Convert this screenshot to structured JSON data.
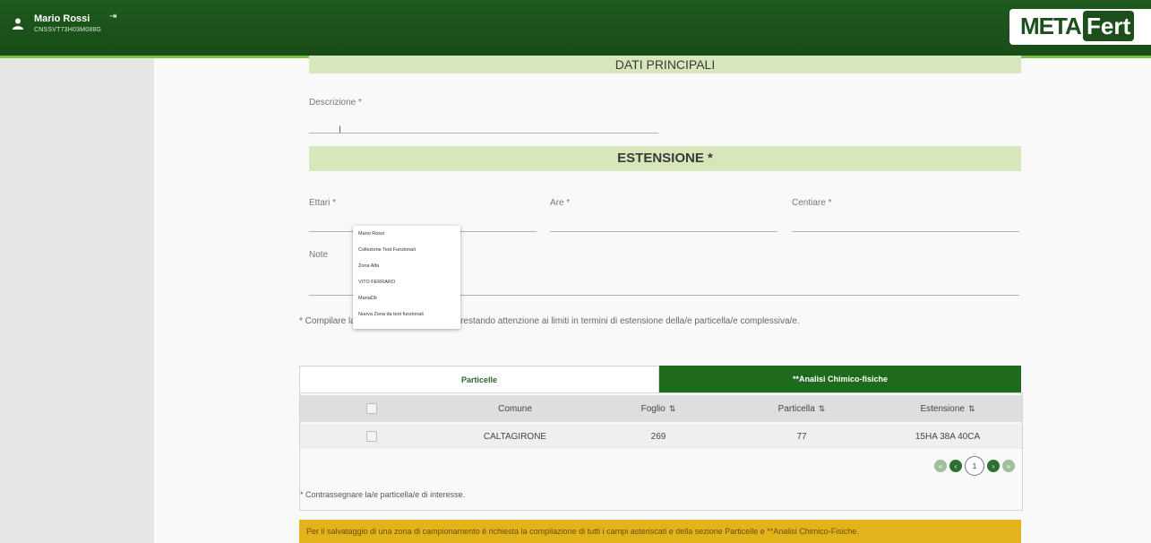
{
  "header": {
    "user_name": "Mario Rossi",
    "user_code": "CNSSVT73H03M088G",
    "brand_meta": "META",
    "brand_fert": "Fert"
  },
  "dati_principali": {
    "title": "DATI PRINCIPALI",
    "descrizione_label": "Descrizione *",
    "descrizione_value": ""
  },
  "estensione": {
    "title": "ESTENSIONE *",
    "ettari_label": "Ettari *",
    "are_label": "Are *",
    "centiare_label": "Centiare *",
    "note_label": "Note",
    "hint": "* Compilare la zona di campionamento prestando attenzione ai limiti in termini di estensione della/e particella/e complessiva/e."
  },
  "dropdown": {
    "items": [
      "Mario Rossi",
      "Collezione Test Funzionali",
      "Zona Alfa",
      "VITO FERRARO",
      "MariaDb",
      "Nuova Zona da test funzionali"
    ]
  },
  "tabs": {
    "particelle": "Particelle",
    "analisi": "**Analisi Chimico-fisiche"
  },
  "table": {
    "headers": {
      "comune": "Comune",
      "foglio": "Foglio",
      "particella": "Particella",
      "estensione": "Estensione"
    },
    "rows": [
      {
        "comune": "CALTAGIRONE",
        "foglio": "269",
        "particella": "77",
        "estensione": "15HA 38A 40CA"
      }
    ],
    "page": "1",
    "note": "* Contrassegnare la/e particella/e di interesse."
  },
  "warning": "Per il salvataggio di una zona di campionamento è richiesta la compilazione di tutti i campi asteriscati e della sezione Particelle e **Analisi Chimico-Fisiche.",
  "icons": {
    "user": "user-icon",
    "logout": "logout-icon",
    "sort": "sort-icon",
    "first": "first-page-icon",
    "prev": "prev-page-icon",
    "next": "next-page-icon",
    "last": "last-page-icon"
  },
  "colors": {
    "header_green": "#1f5a1f",
    "accent_green": "#7ec243",
    "band_green": "#d8e6bb",
    "tab_active": "#1e6b1e",
    "warning": "#e3b31c"
  }
}
